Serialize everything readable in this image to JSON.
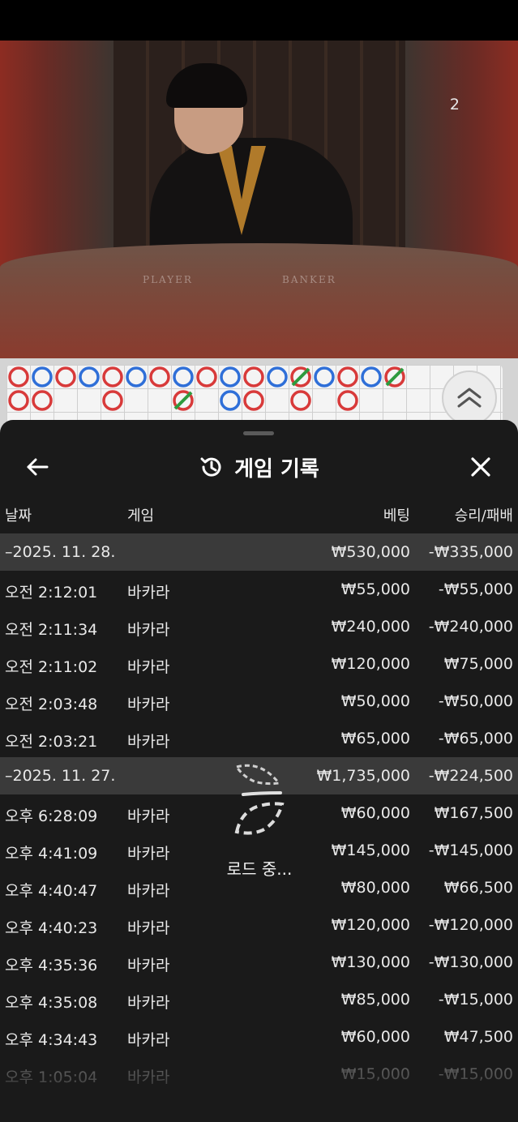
{
  "video": {
    "table_player": "PLAYER",
    "table_banker": "BANKER",
    "counter": "2"
  },
  "sheet": {
    "title": "게임 기록",
    "icons": {
      "back": "arrow-left-icon",
      "history": "history-icon",
      "close": "close-icon",
      "expand": "chevron-up-icon"
    },
    "columns": {
      "date": "날짜",
      "game": "게임",
      "bet": "베팅",
      "result": "승리/패배"
    },
    "rows": [
      {
        "type": "date",
        "date": "–2025. 11. 28.",
        "bet": "₩530,000",
        "result": "-₩335,000"
      },
      {
        "type": "item",
        "time": "오전 2:12:01",
        "game": "바카라",
        "bet": "₩55,000",
        "result": "-₩55,000"
      },
      {
        "type": "item",
        "time": "오전 2:11:34",
        "game": "바카라",
        "bet": "₩240,000",
        "result": "-₩240,000"
      },
      {
        "type": "item",
        "time": "오전 2:11:02",
        "game": "바카라",
        "bet": "₩120,000",
        "result": "₩75,000"
      },
      {
        "type": "item",
        "time": "오전 2:03:48",
        "game": "바카라",
        "bet": "₩50,000",
        "result": "-₩50,000"
      },
      {
        "type": "item",
        "time": "오전 2:03:21",
        "game": "바카라",
        "bet": "₩65,000",
        "result": "-₩65,000"
      },
      {
        "type": "date",
        "date": "–2025. 11. 27.",
        "bet": "₩1,735,000",
        "result": "-₩224,500"
      },
      {
        "type": "item",
        "time": "오후 6:28:09",
        "game": "바카라",
        "bet": "₩60,000",
        "result": "₩167,500"
      },
      {
        "type": "item",
        "time": "오후 4:41:09",
        "game": "바카라",
        "bet": "₩145,000",
        "result": "-₩145,000"
      },
      {
        "type": "item",
        "time": "오후 4:40:47",
        "game": "바카라",
        "bet": "₩80,000",
        "result": "₩66,500"
      },
      {
        "type": "item",
        "time": "오후 4:40:23",
        "game": "바카라",
        "bet": "₩120,000",
        "result": "-₩120,000"
      },
      {
        "type": "item",
        "time": "오후 4:35:36",
        "game": "바카라",
        "bet": "₩130,000",
        "result": "-₩130,000"
      },
      {
        "type": "item",
        "time": "오후 4:35:08",
        "game": "바카라",
        "bet": "₩85,000",
        "result": "-₩15,000"
      },
      {
        "type": "item",
        "time": "오후 4:34:43",
        "game": "바카라",
        "bet": "₩60,000",
        "result": "₩47,500"
      },
      {
        "type": "item",
        "time": "오후 1:05:04",
        "game": "바카라",
        "bet": "₩15,000",
        "result": "-₩15,000",
        "faded": true
      }
    ],
    "loading_text": "로드 중..."
  },
  "colors": {
    "banker": "#d83a3a",
    "player": "#2f6fd8",
    "tie": "#2e9a3e",
    "sheet_bg": "#1a1a1a",
    "date_row_bg": "#3a3a3a"
  }
}
